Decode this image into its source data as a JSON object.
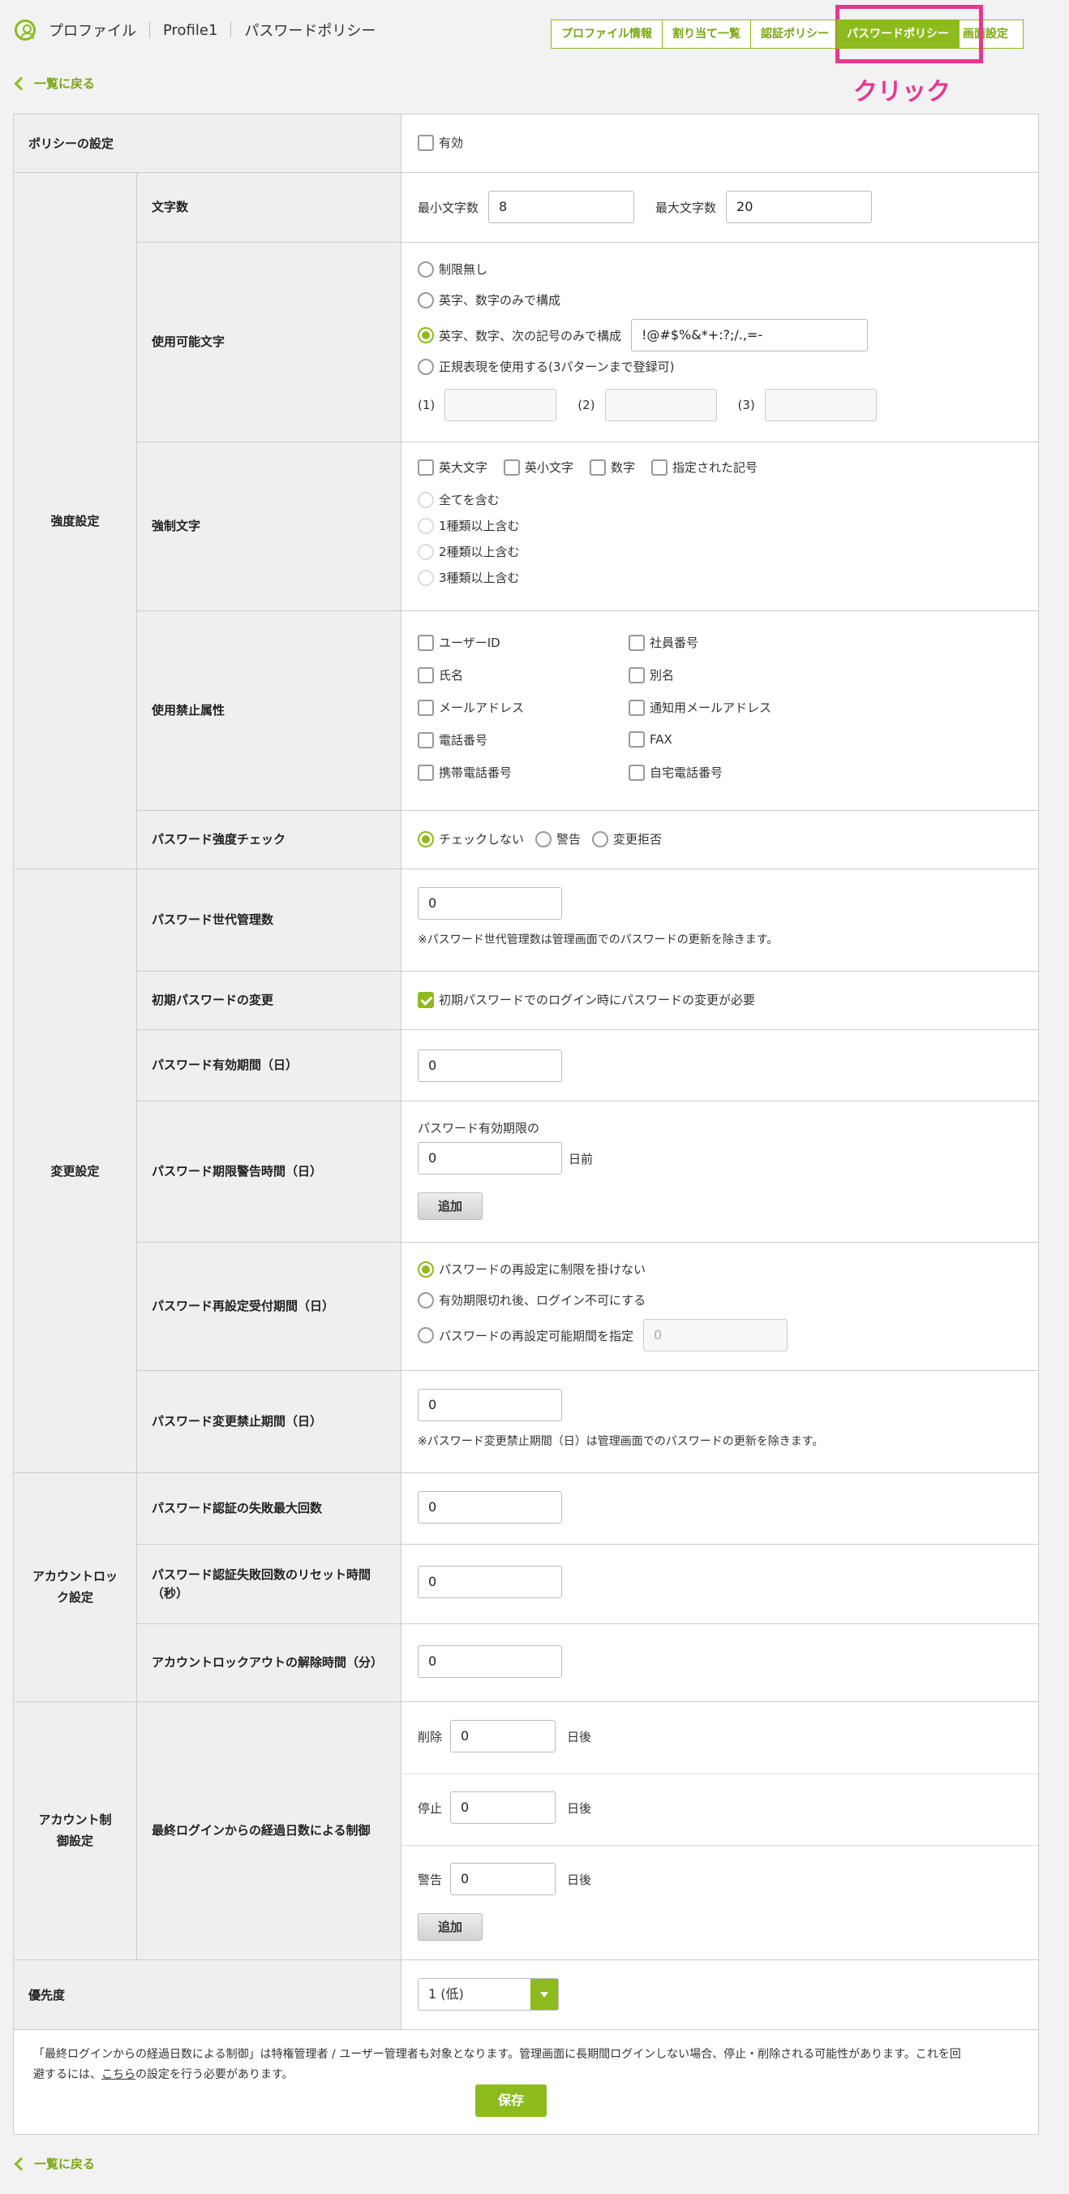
{
  "header": {
    "crumbs": [
      "プロファイル",
      "Profile1",
      "パスワードポリシー"
    ],
    "tabs": [
      "プロファイル情報",
      "割り当て一覧",
      "認証ポリシー",
      "パスワードポリシー",
      "画面設定"
    ],
    "active_tab": "パスワードポリシー",
    "annotation": "クリック"
  },
  "back_link": "一覧に戻る",
  "policy": {
    "label": "ポリシーの設定",
    "enabled_label": "有効"
  },
  "strength": {
    "group_label": "強度設定",
    "length": {
      "label": "文字数",
      "min_label": "最小文字数",
      "min_value": "8",
      "max_label": "最大文字数",
      "max_value": "20"
    },
    "usable": {
      "label": "使用可能文字",
      "options": [
        "制限無し",
        "英字、数字のみで構成",
        "英字、数字、次の記号のみで構成",
        "正規表現を使用する(3パターンまで登録可)"
      ],
      "symbols_value": "!@#$%&*+:?;/.,=-",
      "pattern_labels": [
        "(1)",
        "(2)",
        "(3)"
      ]
    },
    "forced": {
      "label": "強制文字",
      "checks": [
        "英大文字",
        "英小文字",
        "数字",
        "指定された記号"
      ],
      "levels": [
        "全てを含む",
        "1種類以上含む",
        "2種類以上含む",
        "3種類以上含む"
      ]
    },
    "forbidden": {
      "label": "使用禁止属性",
      "items": [
        "ユーザーID",
        "社員番号",
        "氏名",
        "別名",
        "メールアドレス",
        "通知用メールアドレス",
        "電話番号",
        "FAX",
        "携帯電話番号",
        "自宅電話番号"
      ]
    },
    "check": {
      "label": "パスワード強度チェック",
      "options": [
        "チェックしない",
        "警告",
        "変更拒否"
      ]
    }
  },
  "change": {
    "group_label": "変更設定",
    "history": {
      "label": "パスワード世代管理数",
      "value": "0",
      "note": "※パスワード世代管理数は管理画面でのパスワードの更新を除きます。"
    },
    "initial": {
      "label": "初期パスワードの変更",
      "check_label": "初期パスワードでのログイン時にパスワードの変更が必要"
    },
    "validity": {
      "label": "パスワード有効期間（日）",
      "value": "0"
    },
    "warning": {
      "label": "パスワード期限警告時間（日）",
      "prefix": "パスワード有効期限の",
      "value": "0",
      "suffix": "日前",
      "add": "追加"
    },
    "reset": {
      "label": "パスワード再設定受付期間（日）",
      "options": [
        "パスワードの再設定に制限を掛けない",
        "有効期限切れ後、ログイン不可にする",
        "パスワードの再設定可能期間を指定"
      ],
      "value": "0"
    },
    "forbid": {
      "label": "パスワード変更禁止期間（日）",
      "value": "0",
      "note": "※パスワード変更禁止期間（日）は管理画面でのパスワードの更新を除きます。"
    }
  },
  "lock": {
    "group_label": "アカウントロック設定",
    "fail": {
      "label": "パスワード認証の失敗最大回数",
      "value": "0"
    },
    "reset": {
      "label": "パスワード認証失敗回数のリセット時間（秒）",
      "value": "0"
    },
    "unlock": {
      "label": "アカウントロックアウトの解除時間（分）",
      "value": "0"
    }
  },
  "control": {
    "group_label": "アカウント制御設定",
    "label": "最終ログインからの経過日数による制御",
    "rows": [
      {
        "action": "削除",
        "value": "0",
        "suffix": "日後"
      },
      {
        "action": "停止",
        "value": "0",
        "suffix": "日後"
      },
      {
        "action": "警告",
        "value": "0",
        "suffix": "日後"
      }
    ],
    "add": "追加"
  },
  "priority": {
    "label": "優先度",
    "value": "1 (低)"
  },
  "footer": {
    "notice_1": "「最終ログインからの経過日数による制御」は特権管理者 / ユーザー管理者も対象となります。管理画面に長期間ログインしない場合、停止・削除される可能性があります。これを回",
    "notice_2_pre": "避するには、",
    "notice_link": "こちら",
    "notice_2_post": "の設定を行う必要があります。",
    "save": "保存"
  }
}
